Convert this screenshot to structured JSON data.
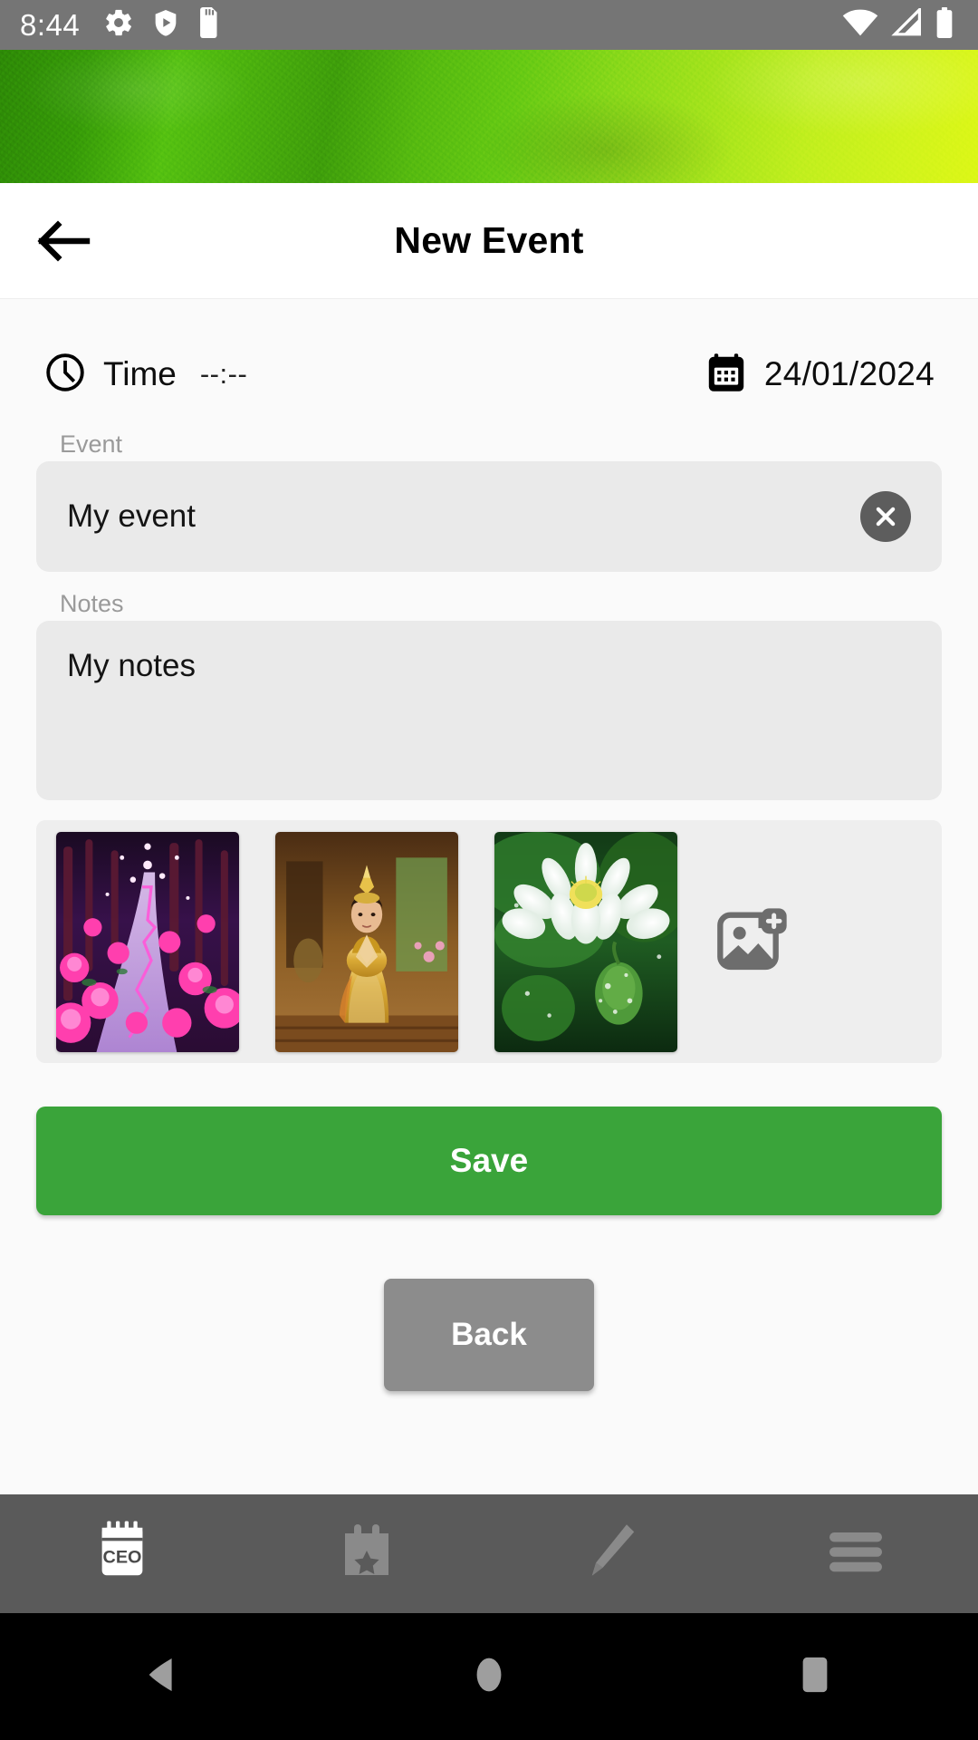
{
  "status_bar": {
    "time": "8:44",
    "left_icons": [
      "gear-icon",
      "play-protect-shield-icon",
      "sd-card-icon"
    ],
    "right_icons": [
      "wifi-icon",
      "cellular-signal-icon",
      "battery-icon"
    ],
    "background_color": "#757575"
  },
  "banner": {
    "name": "green-texture-banner",
    "gradient_from": "#2e8b07",
    "gradient_to": "#ddf717"
  },
  "titlebar": {
    "title": "New Event",
    "back_icon": "arrow-left-icon"
  },
  "form": {
    "time": {
      "icon": "clock-icon",
      "label": "Time",
      "value": "--:--"
    },
    "date": {
      "icon": "calendar-icon",
      "value": "24/01/2024"
    },
    "event": {
      "label": "Event",
      "value": "My event",
      "placeholder": "Event",
      "clear_icon": "close-circle-icon"
    },
    "notes": {
      "label": "Notes",
      "value": "My notes",
      "placeholder": "Notes"
    }
  },
  "gallery": {
    "add_icon": "add-photo-icon",
    "thumbnails": [
      {
        "name": "thumbnail-pink-rose-forest-path",
        "alt": "Glowing magenta rose forest path at night"
      },
      {
        "name": "thumbnail-thai-woman-golden-dress",
        "alt": "Woman in golden Thai costume praying in temple"
      },
      {
        "name": "thumbnail-white-lotus-flower",
        "alt": "White lotus flower with dew on green leaves"
      }
    ]
  },
  "actions": {
    "save_label": "Save",
    "save_color": "#3aa43a",
    "back_label": "Back",
    "back_color": "#8c8c8c"
  },
  "app_nav": {
    "background_color": "#5a5a5a",
    "items": [
      {
        "name": "nav-ceo-calendar",
        "icon": "ceo-notepad-icon",
        "label": "CEO",
        "active": true
      },
      {
        "name": "nav-events",
        "icon": "calendar-star-icon",
        "active": false
      },
      {
        "name": "nav-edit",
        "icon": "pencil-icon",
        "active": false
      },
      {
        "name": "nav-menu",
        "icon": "hamburger-menu-icon",
        "active": false
      }
    ]
  },
  "system_nav": {
    "background_color": "#000000",
    "items": [
      {
        "name": "android-back-button",
        "icon": "triangle-back-icon"
      },
      {
        "name": "android-home-button",
        "icon": "circle-home-icon"
      },
      {
        "name": "android-recents-button",
        "icon": "square-recents-icon"
      }
    ]
  }
}
